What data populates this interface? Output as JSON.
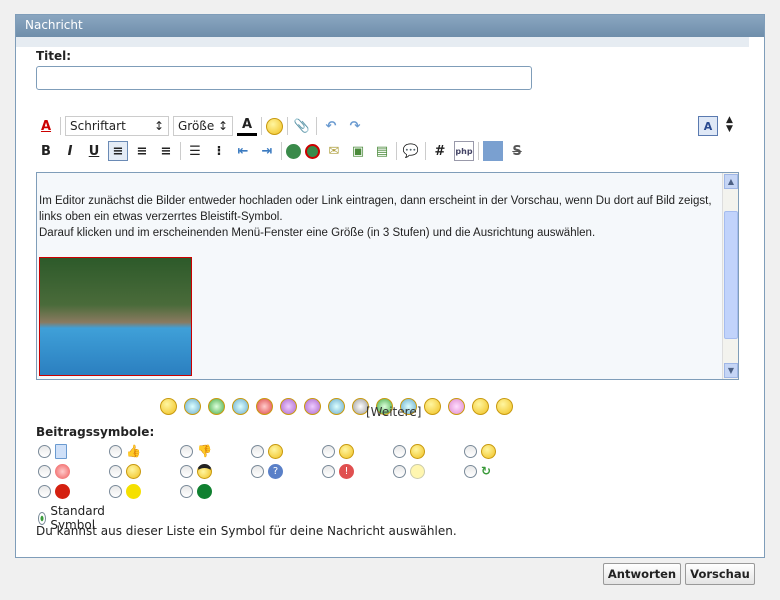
{
  "panel": {
    "title": "Nachricht"
  },
  "form": {
    "title_label": "Titel:",
    "title_value": ""
  },
  "toolbar": {
    "font_select": "Schriftart",
    "size_select": "Größe",
    "bold": "B",
    "italic": "I",
    "underline": "U",
    "hash": "#"
  },
  "editor": {
    "lines": [
      "Im Editor zunächst die Bilder entweder hochladen oder Link eintragen, dann erscheint in der Vorschau, wenn Du dort auf Bild  zeigst, links oben ein etwas verzerrtes Bleistift-Symbol.",
      "Darauf klicken und im erscheinenden Menü-Fenster eine Größe (in 3 Stufen) und die Ausrichtung auswählen."
    ]
  },
  "smilies": {
    "more_link": "[Weitere]"
  },
  "post_icons": {
    "label": "Beitragssymbole:",
    "standard_label": "Standard Symbol",
    "hint": "Du kannst aus dieser Liste ein Symbol für deine Nachricht auswählen.",
    "icons": [
      "document",
      "thumbs-up",
      "thumbs-down",
      "grin",
      "smile",
      "laugh",
      "sad",
      "angry",
      "happy",
      "cool",
      "question",
      "exclamation",
      "lightbulb",
      "refresh",
      "red-dot",
      "yellow-dot",
      "green-dot"
    ],
    "colors": {
      "red": "#d42010",
      "yellow": "#f5e000",
      "green": "#108030"
    }
  },
  "buttons": {
    "reply": "Antworten",
    "preview": "Vorschau"
  }
}
